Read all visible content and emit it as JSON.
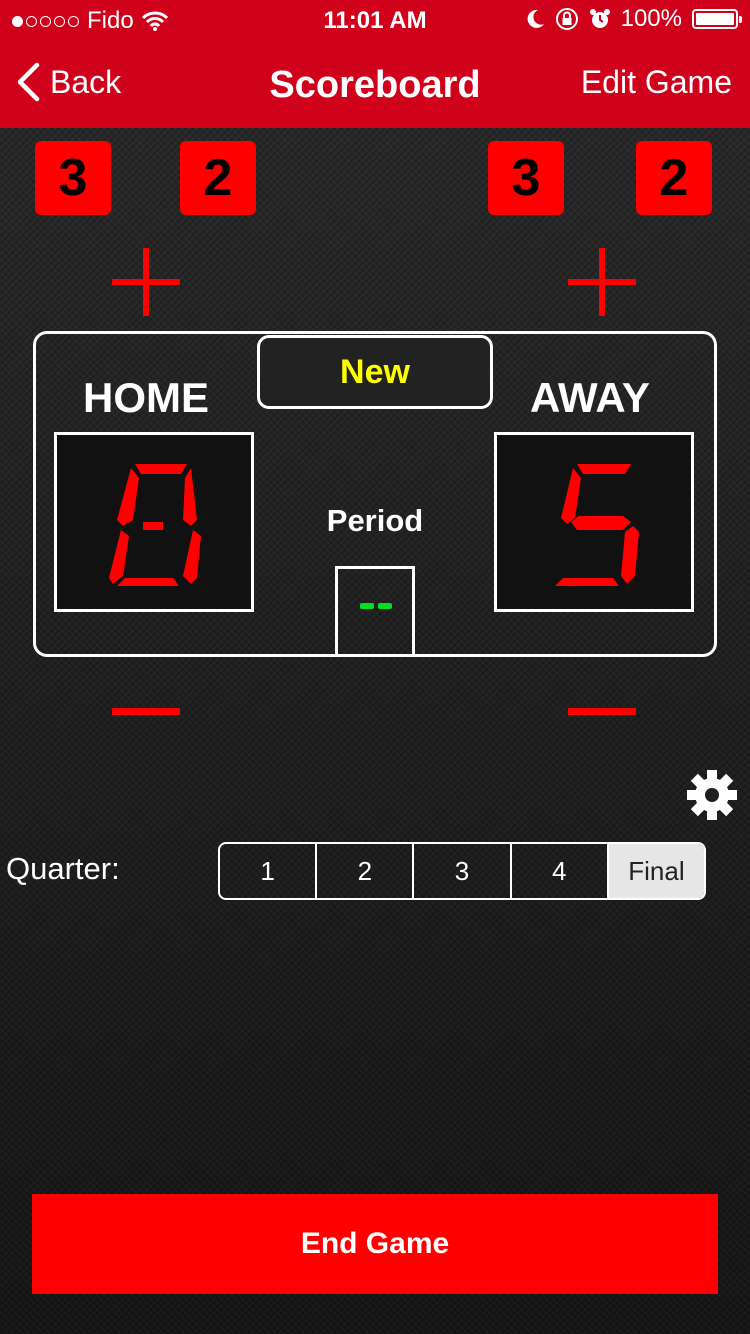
{
  "status_bar": {
    "carrier": "Fido",
    "signal_bars_filled": 1,
    "signal_bars_total": 5,
    "time": "11:01 AM",
    "battery_percent": "100%"
  },
  "nav": {
    "back_label": "Back",
    "title": "Scoreboard",
    "edit_label": "Edit Game"
  },
  "home": {
    "label": "HOME",
    "score": "0",
    "fouls_left": "3",
    "fouls_right": "2"
  },
  "away": {
    "label": "AWAY",
    "score": "5",
    "fouls_left": "3",
    "fouls_right": "2"
  },
  "status_label": "New",
  "period": {
    "label": "Period",
    "value": "--"
  },
  "quarter": {
    "label": "Quarter:",
    "options": [
      "1",
      "2",
      "3",
      "4",
      "Final"
    ],
    "selected": "Final"
  },
  "end_game_label": "End Game",
  "colors": {
    "nav_bg": "#d0021b",
    "accent_red": "#ff0000",
    "status_yellow": "#ffff00",
    "period_green": "#00e020"
  },
  "icons": [
    "chevron-left-icon",
    "wifi-icon",
    "moon-icon",
    "rotation-lock-icon",
    "alarm-icon",
    "battery-icon",
    "plus-icon",
    "minus-icon",
    "gear-icon"
  ]
}
